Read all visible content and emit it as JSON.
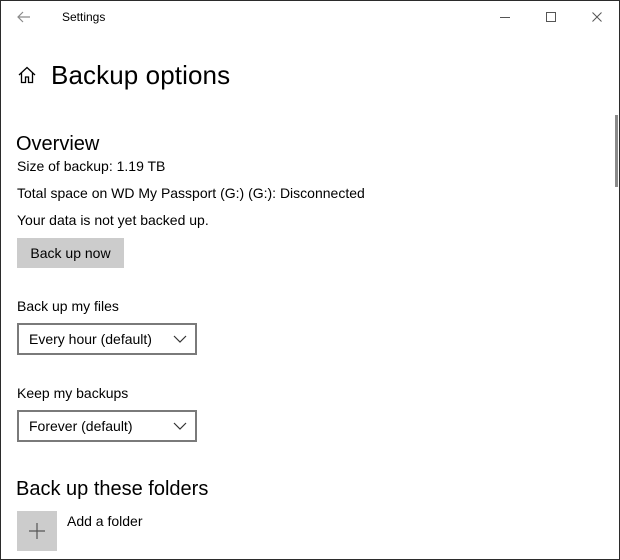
{
  "window": {
    "app_title": "Settings"
  },
  "header": {
    "title": "Backup options"
  },
  "overview": {
    "title": "Overview",
    "size_of_backup": "Size of backup: 1.19 TB",
    "total_space": "Total space on WD My Passport (G:) (G:): Disconnected",
    "status": "Your data is not yet backed up.",
    "back_up_now_label": "Back up now"
  },
  "frequency": {
    "label": "Back up my files",
    "selected": "Every hour (default)"
  },
  "retention": {
    "label": "Keep my backups",
    "selected": "Forever (default)"
  },
  "folders": {
    "title": "Back up these folders",
    "add_label": "Add a folder"
  },
  "icons": {
    "back": "back-arrow-icon",
    "home": "home-icon",
    "minimize": "minimize-icon",
    "maximize": "maximize-icon",
    "close": "close-icon",
    "chevron": "chevron-down-icon",
    "plus": "plus-icon"
  }
}
